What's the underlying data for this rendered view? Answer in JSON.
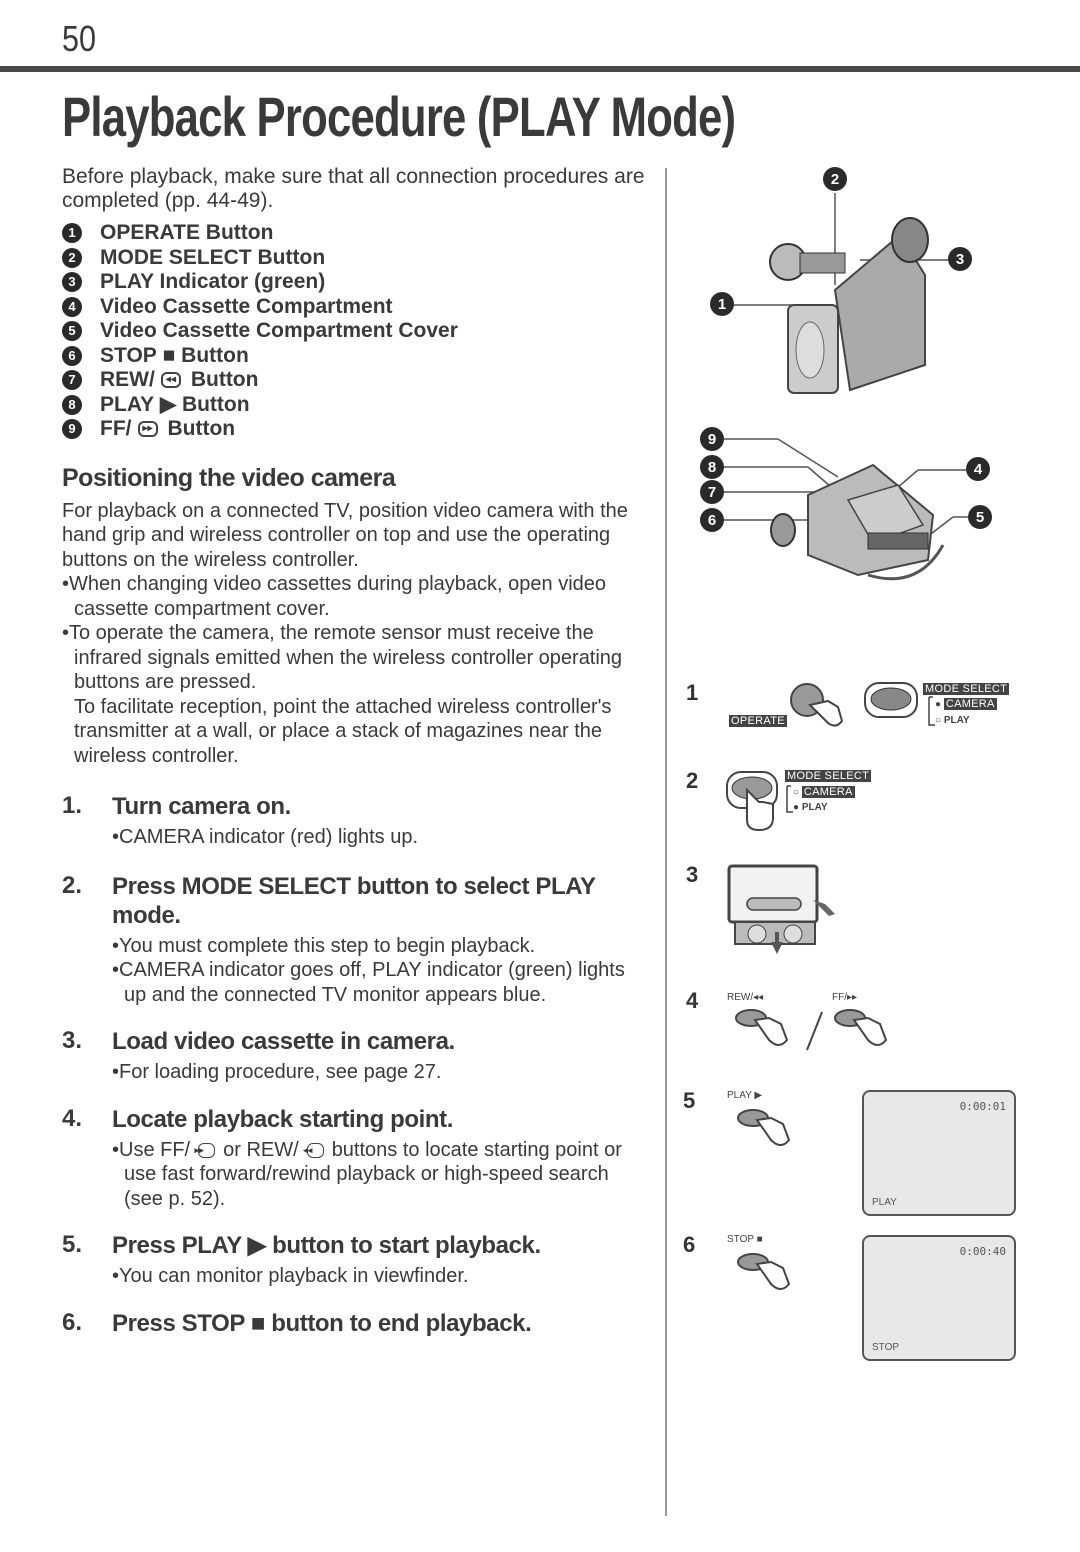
{
  "page": {
    "number": "50",
    "title": "Playback Procedure (PLAY Mode)"
  },
  "intro": "Before playback, make sure that all connection procedures are completed (pp. 44-49).",
  "parts": [
    {
      "num": "1",
      "label": "OPERATE Button"
    },
    {
      "num": "2",
      "label": "MODE SELECT Button"
    },
    {
      "num": "3",
      "label": "PLAY Indicator (green)"
    },
    {
      "num": "4",
      "label": "Video Cassette Compartment"
    },
    {
      "num": "5",
      "label": "Video Cassette Compartment Cover"
    },
    {
      "num": "6",
      "label_pre": "STOP",
      "icon": "■",
      "label_post": "Button"
    },
    {
      "num": "7",
      "label_pre": "REW/",
      "icon": "◂◂",
      "label_post": "Button"
    },
    {
      "num": "8",
      "label_pre": "PLAY",
      "icon": "▶",
      "label_post": "Button"
    },
    {
      "num": "9",
      "label_pre": "FF/",
      "icon": "▸▸",
      "label_post": "Button"
    }
  ],
  "positioning": {
    "heading": "Positioning the video camera",
    "para": "For playback on a connected TV, position video camera with the hand grip and wireless controller on top and use the operating buttons on the wireless controller.",
    "bullets": [
      "•When changing video cassettes during playback, open video cassette compartment cover.",
      "•To operate the camera, the remote sensor must receive the infrared signals emitted when the wireless controller operating buttons are pressed."
    ],
    "bullet_cont": "To facilitate reception, point the attached wireless controller's transmitter at a wall, or place a stack of magazines near the wireless controller."
  },
  "steps": [
    {
      "n": "1.",
      "head": "Turn camera on.",
      "subs": [
        "•CAMERA indicator (red) lights up."
      ]
    },
    {
      "n": "2.",
      "head": "Press MODE SELECT button to select PLAY mode.",
      "subs": [
        "•You must complete this step to begin playback.",
        "•CAMERA indicator goes off, PLAY indicator (green) lights up and the connected TV monitor appears blue."
      ]
    },
    {
      "n": "3.",
      "head": "Load video cassette in camera.",
      "subs": [
        "•For loading procedure, see page 27."
      ]
    },
    {
      "n": "4.",
      "head": "Locate playback starting point.",
      "sub4": {
        "a": "•Use FF/",
        "ff_icon": "▸▸",
        "b": "or REW/",
        "rew_icon": "◂◂",
        "c": "buttons to locate starting point or use fast forward/rewind playback or high-speed search (see p. 52)."
      }
    },
    {
      "n": "5.",
      "head_pre": "Press PLAY",
      "head_icon": "▶",
      "head_post": "button to start playback.",
      "subs": [
        "•You can monitor playback in viewfinder."
      ]
    },
    {
      "n": "6.",
      "head_pre": "Press STOP",
      "head_icon": "■",
      "head_post": "button to end playback."
    }
  ],
  "figures": {
    "camera_top_callouts": [
      "1",
      "2",
      "3"
    ],
    "camera_side_callouts": [
      "9",
      "8",
      "7",
      "6",
      "4",
      "5"
    ],
    "step_numbers": [
      "1",
      "2",
      "3",
      "4",
      "5",
      "6"
    ],
    "fig1": {
      "operate": "OPERATE",
      "mode_select": "MODE SELECT",
      "camera": "CAMERA",
      "play": "PLAY"
    },
    "fig2": {
      "mode_select": "MODE SELECT",
      "camera": "CAMERA",
      "play": "PLAY"
    },
    "fig4": {
      "rew": "REW/◂◂",
      "ff": "FF/▸▸"
    },
    "fig5": {
      "button": "PLAY ▶",
      "timecode": "0:00:01",
      "status": "PLAY"
    },
    "fig6": {
      "button": "STOP ■",
      "timecode": "0:00:40",
      "status": "STOP"
    }
  }
}
